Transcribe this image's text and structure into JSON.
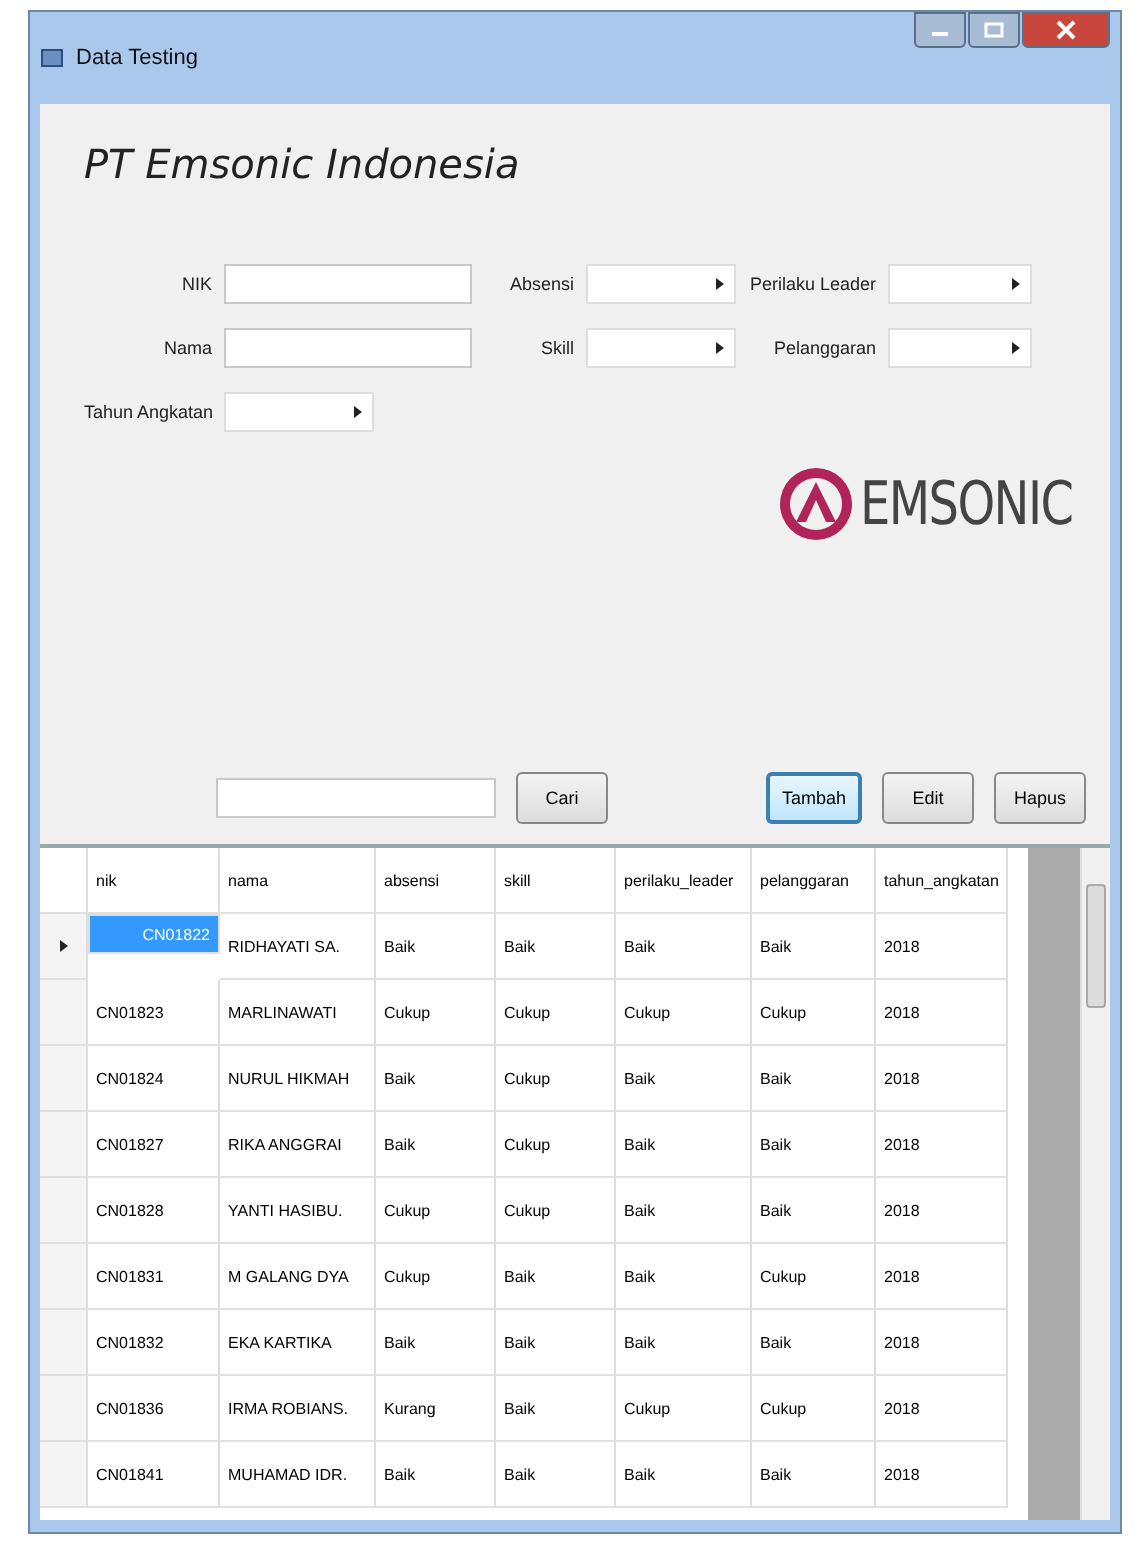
{
  "window": {
    "title": "Data Testing"
  },
  "header": {
    "company": "PT Emsonic Indonesia",
    "logo_text": "EMSONIC"
  },
  "form": {
    "fields": [
      {
        "kind": "text",
        "label": "NIK"
      },
      {
        "kind": "select",
        "label": "Absensi"
      },
      {
        "kind": "select",
        "label": "Perilaku Leader"
      },
      {
        "kind": "text",
        "label": "Nama"
      },
      {
        "kind": "select",
        "label": "Skill"
      },
      {
        "kind": "select",
        "label": "Pelanggaran"
      },
      {
        "kind": "select",
        "label": "Tahun Angkatan"
      }
    ]
  },
  "search_button": "Cari",
  "buttons": [
    {
      "label": "Tambah",
      "focused": true
    },
    {
      "label": "Edit",
      "focused": false
    },
    {
      "label": "Hapus",
      "focused": false
    }
  ],
  "table": {
    "columns": [
      "nik",
      "nama",
      "absensi",
      "skill",
      "perilaku_leader",
      "pelanggaran",
      "tahun_angkatan"
    ],
    "rows": [
      {
        "selected": true,
        "cells": [
          "CN01822",
          "RIDHAYATI SA.",
          "Baik",
          "Baik",
          "Baik",
          "Baik",
          "2018"
        ]
      },
      {
        "selected": false,
        "cells": [
          "CN01823",
          "MARLINAWATI",
          "Cukup",
          "Cukup",
          "Cukup",
          "Cukup",
          "2018"
        ]
      },
      {
        "selected": false,
        "cells": [
          "CN01824",
          "NURUL HIKMAH",
          "Baik",
          "Cukup",
          "Baik",
          "Baik",
          "2018"
        ]
      },
      {
        "selected": false,
        "cells": [
          "CN01827",
          "RIKA ANGGRAI",
          "Baik",
          "Cukup",
          "Baik",
          "Baik",
          "2018"
        ]
      },
      {
        "selected": false,
        "cells": [
          "CN01828",
          "YANTI HASIBU.",
          "Cukup",
          "Cukup",
          "Baik",
          "Baik",
          "2018"
        ]
      },
      {
        "selected": false,
        "cells": [
          "CN01831",
          "M GALANG DYA",
          "Cukup",
          "Baik",
          "Baik",
          "Cukup",
          "2018"
        ]
      },
      {
        "selected": false,
        "cells": [
          "CN01832",
          "EKA KARTIKA",
          "Baik",
          "Baik",
          "Baik",
          "Baik",
          "2018"
        ]
      },
      {
        "selected": false,
        "cells": [
          "CN01836",
          "IRMA ROBIANS.",
          "Kurang",
          "Baik",
          "Cukup",
          "Cukup",
          "2018"
        ]
      },
      {
        "selected": false,
        "cells": [
          "CN01841",
          "MUHAMAD IDR.",
          "Baik",
          "Baik",
          "Baik",
          "Baik",
          "2018"
        ]
      }
    ]
  }
}
